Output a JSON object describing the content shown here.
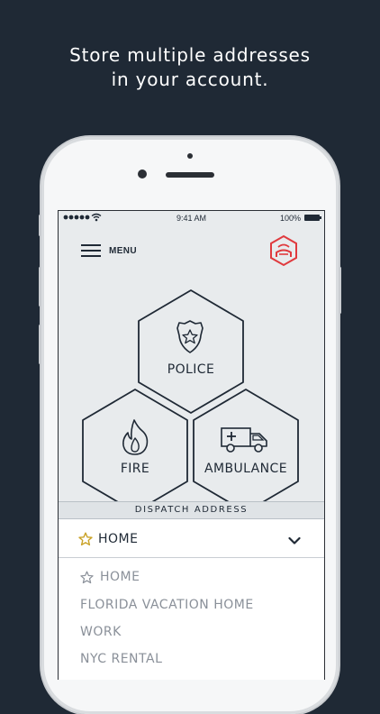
{
  "caption": {
    "line1": "Store multiple addresses",
    "line2": "in your account."
  },
  "status_bar": {
    "signal_icon": "signal-dots-icon",
    "wifi_icon": "wifi-icon",
    "time": "9:41 AM",
    "battery": "100%",
    "battery_icon": "battery-icon"
  },
  "header": {
    "menu_icon": "hamburger-menu-icon",
    "menu_label": "MENU",
    "logo_icon": "hexagon-car-logo-icon"
  },
  "services": {
    "police": {
      "label": "POLICE",
      "icon": "police-badge-icon"
    },
    "fire": {
      "label": "FIRE",
      "icon": "flame-icon"
    },
    "ambulance": {
      "label": "AMBULANCE",
      "icon": "ambulance-icon"
    }
  },
  "dispatch": {
    "title": "DISPATCH ADDRESS",
    "selected": "HOME",
    "selected_icon": "star-icon",
    "dropdown_icon": "chevron-down-icon",
    "options": [
      "HOME",
      "FLORIDA VACATION HOME",
      "WORK",
      "NYC RENTAL"
    ]
  },
  "colors": {
    "background": "#1f2935",
    "screen": "#e8ebed",
    "ink": "#1f2935",
    "logo_red": "#e03a3e",
    "star_gold": "#c9a227",
    "muted_text": "#8a9099"
  }
}
